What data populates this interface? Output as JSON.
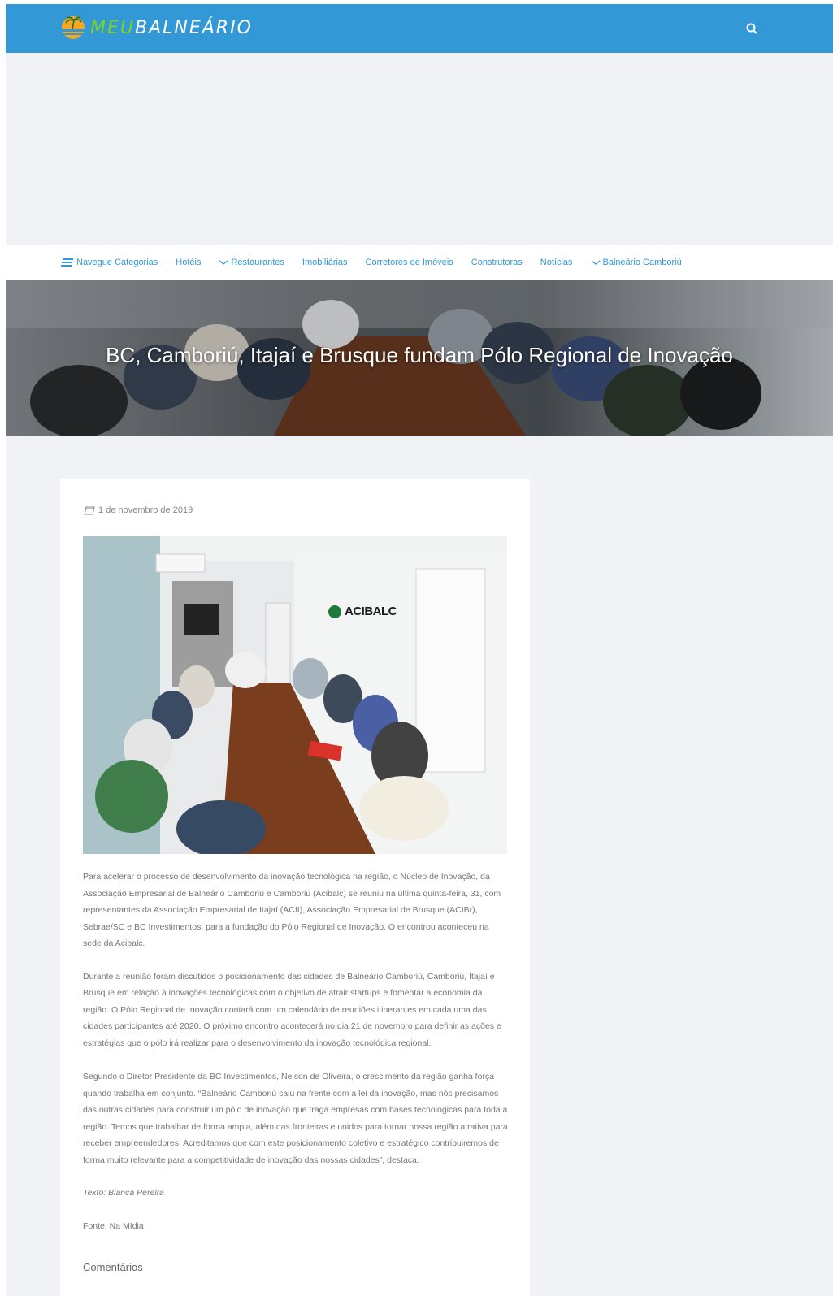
{
  "header": {
    "logo_part1": "MEU",
    "logo_part2": "BALNEÁRIO",
    "accent_color": "#3399d6",
    "logo_accent": "#7ed321"
  },
  "nav": {
    "items": [
      {
        "label": "Navegue Categorias",
        "icon": "menu-icon"
      },
      {
        "label": "Hotéis"
      },
      {
        "label": "Restaurantes",
        "icon": "chevron-down-icon"
      },
      {
        "label": "Imobiliárias"
      },
      {
        "label": "Corretores de Imóveis"
      },
      {
        "label": "Construtoras"
      },
      {
        "label": "Notícias"
      },
      {
        "label": "Balneário Camboriú",
        "icon": "chevron-down-icon"
      }
    ]
  },
  "hero": {
    "title": "BC, Camboriú, Itajaí e Brusque fundam Pólo Regional de Inovação"
  },
  "article": {
    "date": "1 de novembro de 2019",
    "paragraphs": [
      "Para acelerar o processo de desenvolvimento da inovação tecnológica na região, o Núcleo de Inovação, da Associação Empresarial de Balneário Camboriú e Camboriú (Acibalc) se reuniu na última quinta-feira, 31, com representantes da Associação Empresarial de Itajaí (ACII), Associação Empresarial de Brusque (ACIBr), Sebrae/SC e BC Investimentos, para a fundação do Pólo Regional de Inovação. O encontrou aconteceu na sede da Acibalc.",
      "Durante a reunião foram discutidos o posicionamento das cidades de Balneário Camboriú, Camboriú, Itajaí e Brusque em relação à inovações tecnológicas com o objetivo de atrair startups e fomentar a economia da região. O Pólo Regional de Inovação contará com um calendário de reuniões itinerantes em cada uma das cidades participantes até 2020. O próximo encontro acontecerá no dia 21 de novembro para definir as ações e estratégias que o pólo irá realizar para o desenvolvimento da inovação tecnológica regional.",
      "Segundo o Diretor Presidente da BC Investimentos, Nelson de Oliveira, o crescimento da região ganha força quando trabalha em conjunto. “Balneário Camboriú saiu na frente com a lei da inovação, mas nós precisamos das outras cidades para construir um pólo de inovação que traga empresas com bases tecnológicas para toda a região. Temos que trabalhar de forma ampla, além das fronteiras e unidos para tornar nossa região atrativa para receber empreendedores. Acreditamos que com este posicionamento coletivo e estratégico contribuiremos de forma muito relevante para a competitividade de inovação das nossas cidades”, destaca."
    ],
    "credit_text": "Texto: Bianca Pereira",
    "source": "Fonte: Na Mídia",
    "image_sign": "ACIBALC"
  },
  "comments": {
    "title": "Comentários"
  }
}
